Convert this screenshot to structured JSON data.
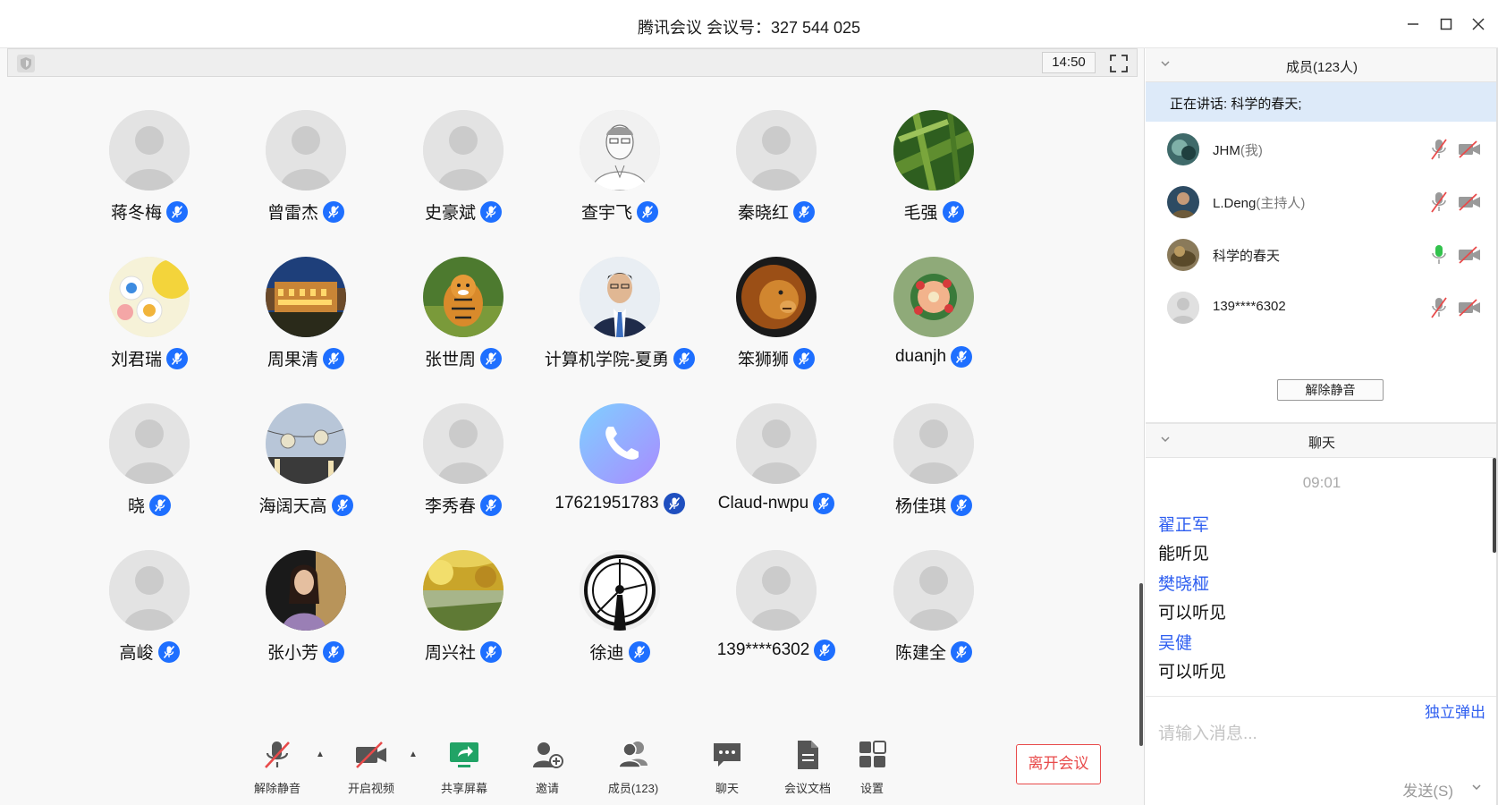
{
  "window": {
    "title": "腾讯会议 会议号：327 544 025",
    "controls": [
      "minimize-icon",
      "maximize-icon",
      "close-icon"
    ]
  },
  "video_toolbar": {
    "timer": "14:50"
  },
  "participants": [
    {
      "name": "蒋冬梅",
      "avatar": "default"
    },
    {
      "name": "曾雷杰",
      "avatar": "default"
    },
    {
      "name": "史豪斌",
      "avatar": "default"
    },
    {
      "name": "查宇飞",
      "avatar": "sketch"
    },
    {
      "name": "秦晓红",
      "avatar": "default"
    },
    {
      "name": "毛强",
      "avatar": "bamboo"
    },
    {
      "name": "刘君瑞",
      "avatar": "paint"
    },
    {
      "name": "周果清",
      "avatar": "building"
    },
    {
      "name": "张世周",
      "avatar": "tiger"
    },
    {
      "name": "计算机学院-夏勇",
      "avatar": "portrait"
    },
    {
      "name": "笨狮狮",
      "avatar": "lion"
    },
    {
      "name": "duanjh",
      "avatar": "flower"
    },
    {
      "name": "晓",
      "avatar": "default"
    },
    {
      "name": "海阔天高",
      "avatar": "lanterns"
    },
    {
      "name": "李秀春",
      "avatar": "default"
    },
    {
      "name": "17621951783",
      "avatar": "phone"
    },
    {
      "name": "Claud-nwpu",
      "avatar": "default"
    },
    {
      "name": "杨佳琪",
      "avatar": "default"
    },
    {
      "name": "高峻",
      "avatar": "default"
    },
    {
      "name": "张小芳",
      "avatar": "woman"
    },
    {
      "name": "周兴社",
      "avatar": "autumn"
    },
    {
      "name": "徐迪",
      "avatar": "clock"
    },
    {
      "name": "139****6302",
      "avatar": "default"
    },
    {
      "name": "陈建全",
      "avatar": "default"
    }
  ],
  "controls": {
    "unmute": "解除静音",
    "video": "开启视频",
    "share": "共享屏幕",
    "invite": "邀请",
    "members": "成员(123)",
    "chat": "聊天",
    "docs": "会议文档",
    "settings": "设置",
    "leave": "离开会议"
  },
  "members_panel": {
    "title": "成员(123人)",
    "speaking": "正在讲话: 科学的春天;",
    "members": [
      {
        "name": "JHM",
        "role": "(我)",
        "mic": "muted",
        "camera": "off"
      },
      {
        "name": "L.Deng",
        "role": "(主持人)",
        "mic": "muted",
        "camera": "off"
      },
      {
        "name": "科学的春天",
        "role": "",
        "mic": "active",
        "camera": "off"
      },
      {
        "name": "139****6302",
        "role": "",
        "mic": "muted",
        "camera": "off"
      }
    ],
    "unmute_all": "解除静音"
  },
  "chat_panel": {
    "title": "聊天",
    "time": "09:01",
    "messages": [
      {
        "sender": "翟正军",
        "text": "能听见"
      },
      {
        "sender": "樊晓桠",
        "text": "可以听见"
      },
      {
        "sender": "吴健",
        "text": "可以听见"
      }
    ],
    "popout": "独立弹出",
    "input_placeholder": "请输入消息...",
    "send": "发送(S)"
  },
  "colors": {
    "accent_blue": "#1e6fff",
    "leave_red": "#e84a4a",
    "speaking_bg": "#ddeaf9",
    "mic_active_green": "#33c24d"
  }
}
